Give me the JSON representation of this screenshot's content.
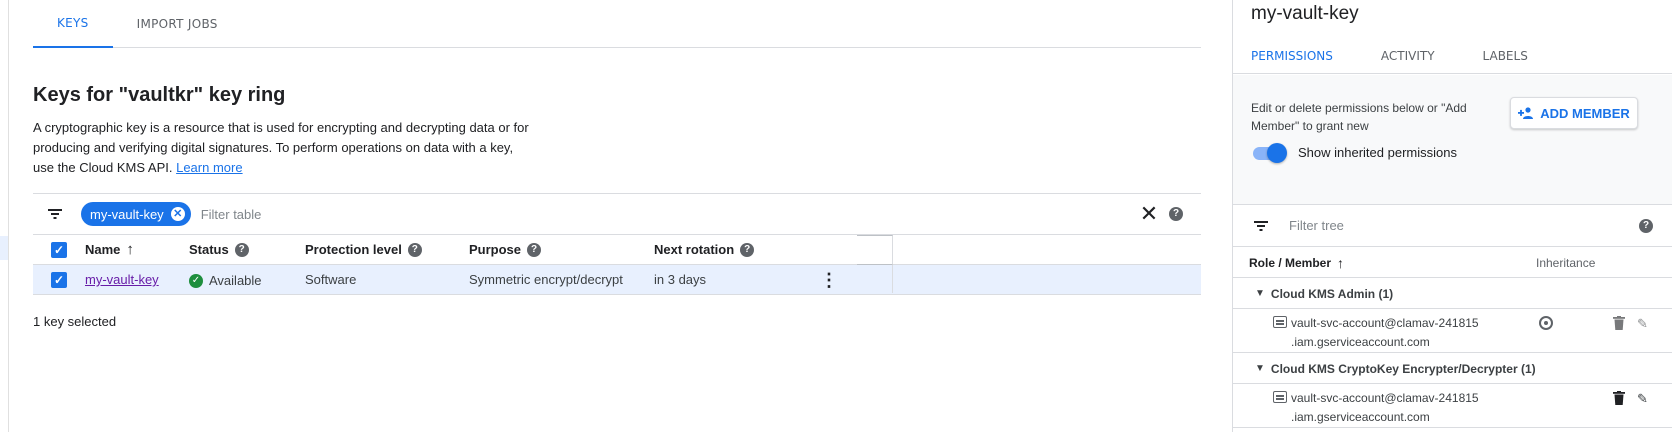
{
  "main": {
    "tabs": [
      {
        "label": "KEYS",
        "active": true
      },
      {
        "label": "IMPORT JOBS",
        "active": false
      }
    ],
    "title": "Keys for \"vaultkr\" key ring",
    "description": "A cryptographic key is a resource that is used for encrypting and decrypting data or for producing and verifying digital signatures. To perform operations on data with a key, use the Cloud KMS API.",
    "learn_more": "Learn more",
    "filter": {
      "chip": "my-vault-key",
      "placeholder": "Filter table"
    },
    "table": {
      "headers": {
        "name": "Name",
        "status": "Status",
        "protection": "Protection level",
        "purpose": "Purpose",
        "rotation": "Next rotation"
      },
      "rows": [
        {
          "name": "my-vault-key",
          "status": "Available",
          "protection": "Software",
          "purpose": "Symmetric encrypt/decrypt",
          "rotation": "in 3 days"
        }
      ]
    },
    "selection_text": "1 key selected"
  },
  "panel": {
    "title": "my-vault-key",
    "tabs": [
      {
        "label": "PERMISSIONS",
        "active": true
      },
      {
        "label": "ACTIVITY",
        "active": false
      },
      {
        "label": "LABELS",
        "active": false
      }
    ],
    "description": "Edit or delete permissions below or \"Add Member\" to grant new",
    "add_member": "ADD MEMBER",
    "toggle_label": "Show inherited permissions",
    "toggle_on": true,
    "tree_filter_placeholder": "Filter tree",
    "tree_headers": {
      "role": "Role / Member",
      "inheritance": "Inheritance"
    },
    "groups": [
      {
        "label": "Cloud KMS Admin (1)",
        "member_line1": "vault-svc-account@clamav-241815",
        "member_line2": ".iam.gserviceaccount.com",
        "inherited": true
      },
      {
        "label": "Cloud KMS CryptoKey Encrypter/Decrypter (1)",
        "member_line1": "vault-svc-account@clamav-241815",
        "member_line2": ".iam.gserviceaccount.com",
        "inherited": false
      }
    ]
  },
  "colors": {
    "accent": "#1a73e8",
    "success": "#1e8e3e",
    "link_visited": "#681da8"
  }
}
